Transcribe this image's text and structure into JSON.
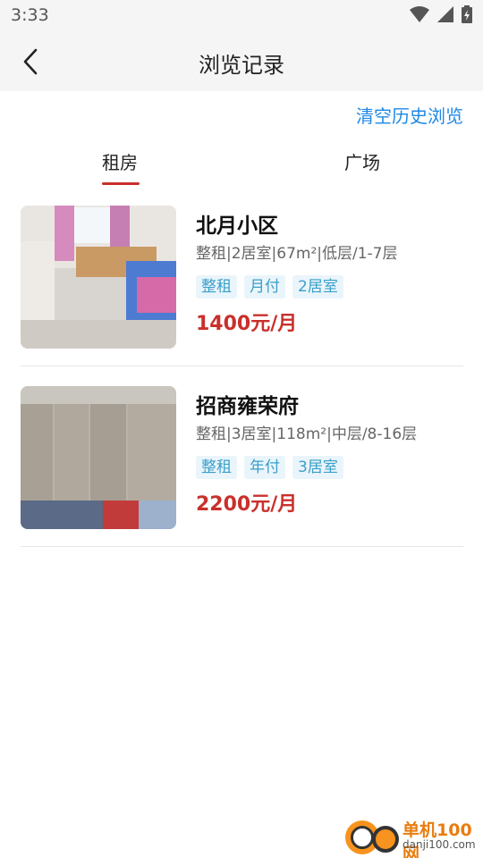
{
  "status_bar": {
    "time": "3:33"
  },
  "header": {
    "title": "浏览记录"
  },
  "actions": {
    "clear_history": "清空历史浏览"
  },
  "tabs": [
    {
      "label": "租房",
      "active": true
    },
    {
      "label": "广场",
      "active": false
    }
  ],
  "listings": [
    {
      "name": "北月小区",
      "desc": "整租|2居室|67m²|低层/1-7层",
      "tags": [
        "整租",
        "月付",
        "2居室"
      ],
      "price": "1400元/月"
    },
    {
      "name": "招商雍荣府",
      "desc": "整租|3居室|118m²|中层/8-16层",
      "tags": [
        "整租",
        "年付",
        "3居室"
      ],
      "price": "2200元/月"
    }
  ],
  "watermark": {
    "title": "单机100网",
    "url": "danji100.com"
  },
  "colors": {
    "accent_red": "#c9302c",
    "link_blue": "#1e88e5",
    "tag_text": "#3a9fc9",
    "tag_bg": "#eaf5fb"
  }
}
